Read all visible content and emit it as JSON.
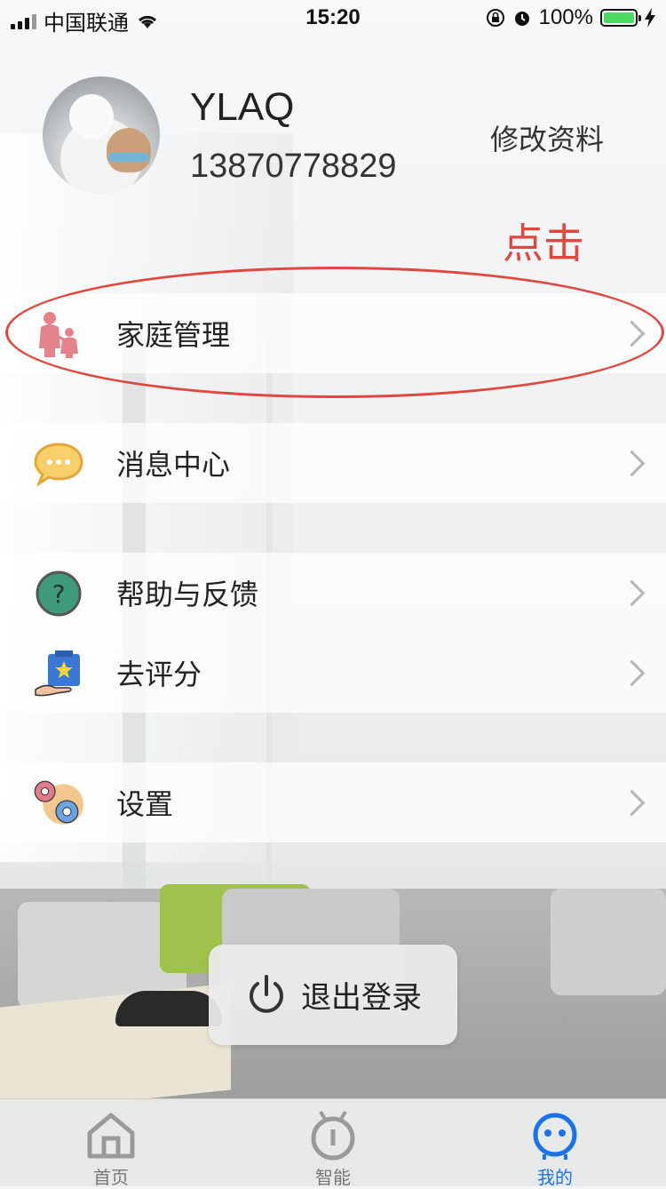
{
  "status_bar": {
    "carrier": "中国联通",
    "time": "15:20",
    "battery_percent": "100%",
    "battery_level": 1.0
  },
  "profile": {
    "username": "YLAQ",
    "phone": "13870778829",
    "edit_label": "修改资料"
  },
  "annotation": {
    "text": "点击",
    "color": "#e0483f"
  },
  "menu": {
    "items": [
      {
        "label": "家庭管理",
        "icon": "family-icon"
      },
      {
        "label": "消息中心",
        "icon": "message-icon"
      },
      {
        "label": "帮助与反馈",
        "icon": "help-icon"
      },
      {
        "label": "去评分",
        "icon": "rate-icon"
      },
      {
        "label": "设置",
        "icon": "settings-gear-icon"
      }
    ]
  },
  "logout": {
    "label": "退出登录",
    "icon": "power-icon"
  },
  "tabbar": {
    "tabs": [
      {
        "label": "首页",
        "icon": "home-icon",
        "active": false
      },
      {
        "label": "智能",
        "icon": "smart-device-icon",
        "active": false
      },
      {
        "label": "我的",
        "icon": "profile-robot-icon",
        "active": true
      }
    ],
    "active_color": "#1a73e8"
  }
}
